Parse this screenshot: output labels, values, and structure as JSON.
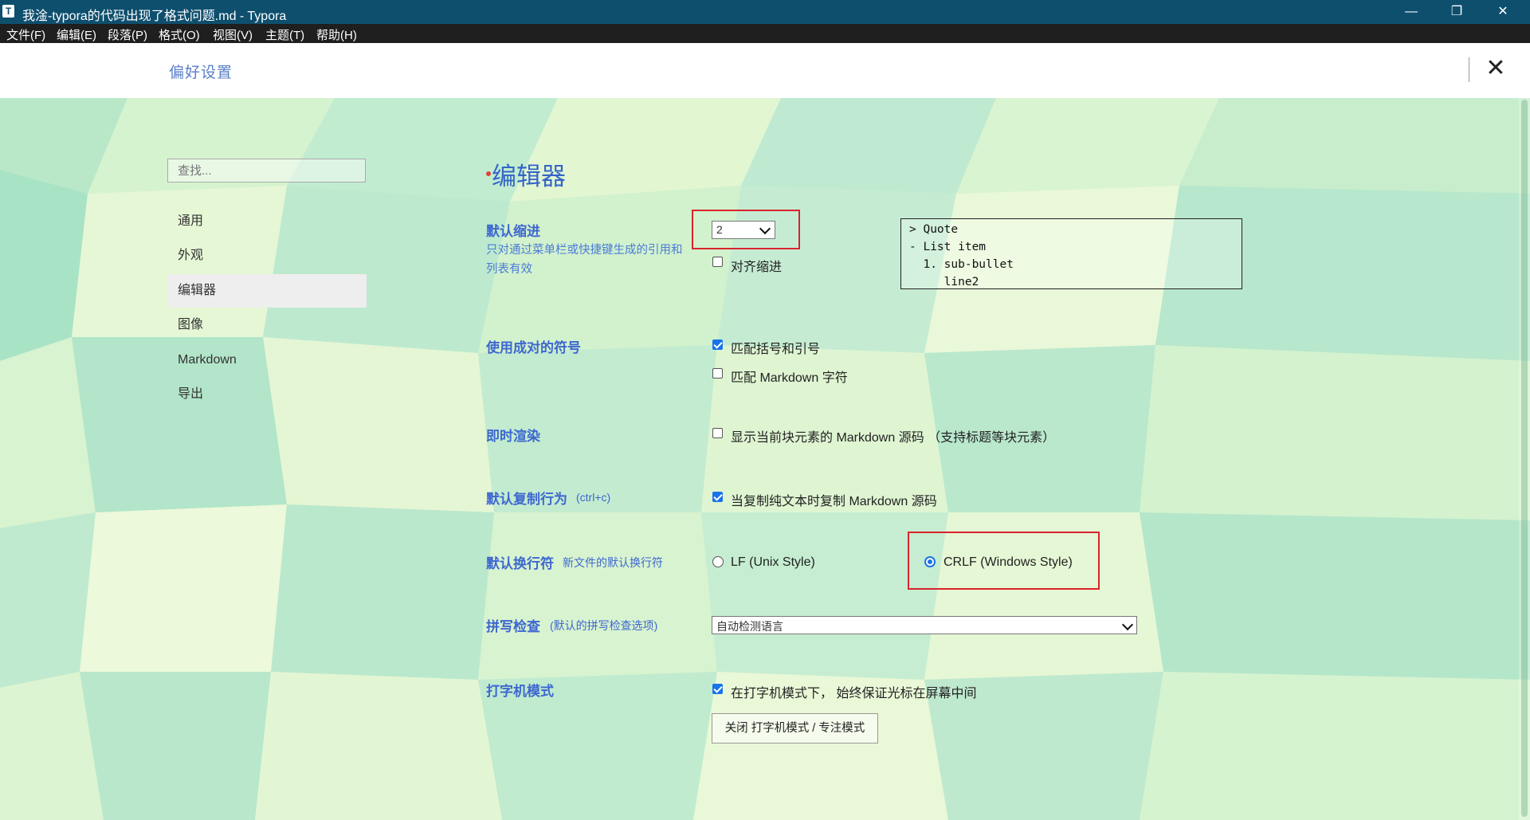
{
  "window": {
    "app_icon": "T",
    "title": "我淦-typora的代码出现了格式问题.md - Typora",
    "buttons": {
      "minimize": "—",
      "restore": "❐",
      "close": "✕"
    }
  },
  "menu": [
    "文件(F)",
    "编辑(E)",
    "段落(P)",
    "格式(O)",
    "视图(V)",
    "主题(T)",
    "帮助(H)"
  ],
  "prefs": {
    "title": "偏好设置",
    "close": "✕"
  },
  "sidebar": {
    "search_placeholder": "查找...",
    "items": [
      {
        "label": "通用"
      },
      {
        "label": "外观"
      },
      {
        "label": "编辑器",
        "active": true
      },
      {
        "label": "图像"
      },
      {
        "label": "Markdown"
      },
      {
        "label": "导出"
      }
    ]
  },
  "editor": {
    "title": "编辑器",
    "indent": {
      "label": "默认缩进",
      "description": "只对通过菜单栏或快捷键生成的引用和列表有效",
      "value": "2",
      "align_label": "对齐缩进",
      "align_checked": false,
      "preview_lines": [
        "> Quote",
        "- List item",
        "  1. sub-bullet",
        "     line2"
      ]
    },
    "pairs": {
      "label": "使用成对的符号",
      "match_brackets_label": "匹配括号和引号",
      "match_brackets_checked": true,
      "match_markdown_label": "匹配 Markdown 字符",
      "match_markdown_checked": false
    },
    "live_render": {
      "label": "即时渲染",
      "option_label": "显示当前块元素的 Markdown 源码 （支持标题等块元素）",
      "checked": false
    },
    "copy": {
      "label": "默认复制行为",
      "hint": "(ctrl+c)",
      "option_label": "当复制纯文本时复制 Markdown 源码",
      "checked": true
    },
    "line_ending": {
      "label": "默认换行符",
      "hint": "新文件的默认换行符",
      "lf_label": "LF (Unix Style)",
      "crlf_label": "CRLF (Windows Style)",
      "selected": "CRLF"
    },
    "spellcheck": {
      "label": "拼写检查",
      "hint": "(默认的拼写检查选项)",
      "value": "自动检测语言"
    },
    "typewriter": {
      "label": "打字机模式",
      "option_label": "在打字机模式下， 始终保证光标在屏幕中间",
      "checked": true,
      "button_label": "关闭 打字机模式 / 专注模式"
    }
  },
  "colors": {
    "accent_blue": "#3d67d0",
    "titlebar": "#0e4f6e",
    "highlight_red": "#d9232d"
  }
}
